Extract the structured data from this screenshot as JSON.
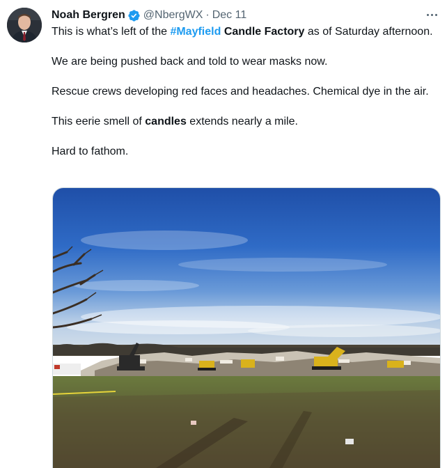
{
  "author": {
    "name": "Noah Bergren",
    "handle": "@NbergWX",
    "separator": "·",
    "date": "Dec 11",
    "verified_icon": "verified-badge-icon",
    "accent": "#1d9bf0"
  },
  "tweet": {
    "line1_prefix": "This is what’s left of the ",
    "hashtag": "#Mayfield",
    "line1_bold": "Candle Factory",
    "line1_suffix": " as of Saturday afternoon.",
    "p2": "We are being pushed back and told to wear masks now.",
    "p3": "Rescue crews developing red faces and headaches. Chemical dye in the air.",
    "p4_prefix": "This eerie smell of ",
    "p4_bold": "candles",
    "p4_suffix": " extends nearly a mile.",
    "p5": "Hard to fathom."
  },
  "media": {
    "kind": "photo",
    "icon": "photo-icon"
  },
  "more_icon": "more-options-icon"
}
